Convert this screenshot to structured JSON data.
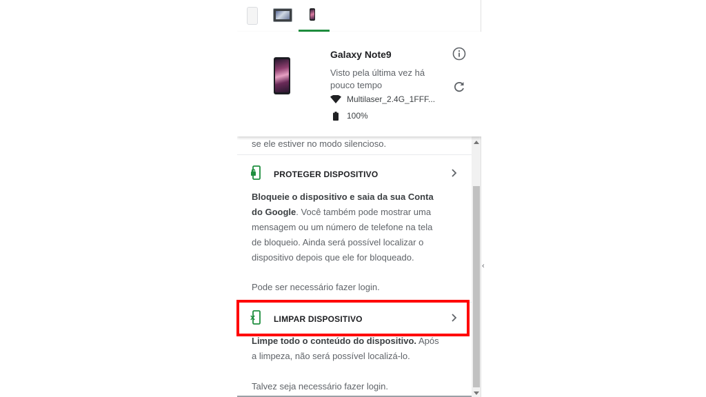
{
  "device_tabs": [
    {
      "name": "device-1",
      "selected": false
    },
    {
      "name": "device-2",
      "selected": false
    },
    {
      "name": "device-3",
      "selected": true
    }
  ],
  "device": {
    "name": "Galaxy Note9",
    "last_seen": "Visto pela última vez há pouco tempo",
    "network": "Multilaser_2.4G_1FFF...",
    "battery": "100%",
    "icons": {
      "info": "info-icon",
      "refresh": "refresh-icon",
      "wifi": "wifi-icon",
      "battery": "battery-icon"
    }
  },
  "content": {
    "partial_text": "se ele estiver no modo silencioso.",
    "secure": {
      "label": "PROTEGER DISPOSITIVO",
      "desc_bold": "Bloqueie o dispositivo e saia da sua Conta do Google",
      "desc_rest": ". Você também pode mostrar uma mensagem ou um número de telefone na tela de bloqueio. Ainda será possível localizar o dispositivo depois que ele for bloqueado.",
      "login_note": "Pode ser necessário fazer login."
    },
    "erase": {
      "label": "LIMPAR DISPOSITIVO",
      "desc_bold": "Limpe todo o conteúdo do dispositivo.",
      "desc_rest": " Após a limpeza, não será possível localizá-lo.",
      "login_note": "Talvez seja necessário fazer login."
    }
  },
  "colors": {
    "accent": "#1e8e3e",
    "highlight": "#ff0000",
    "text_muted": "#5f6368"
  }
}
